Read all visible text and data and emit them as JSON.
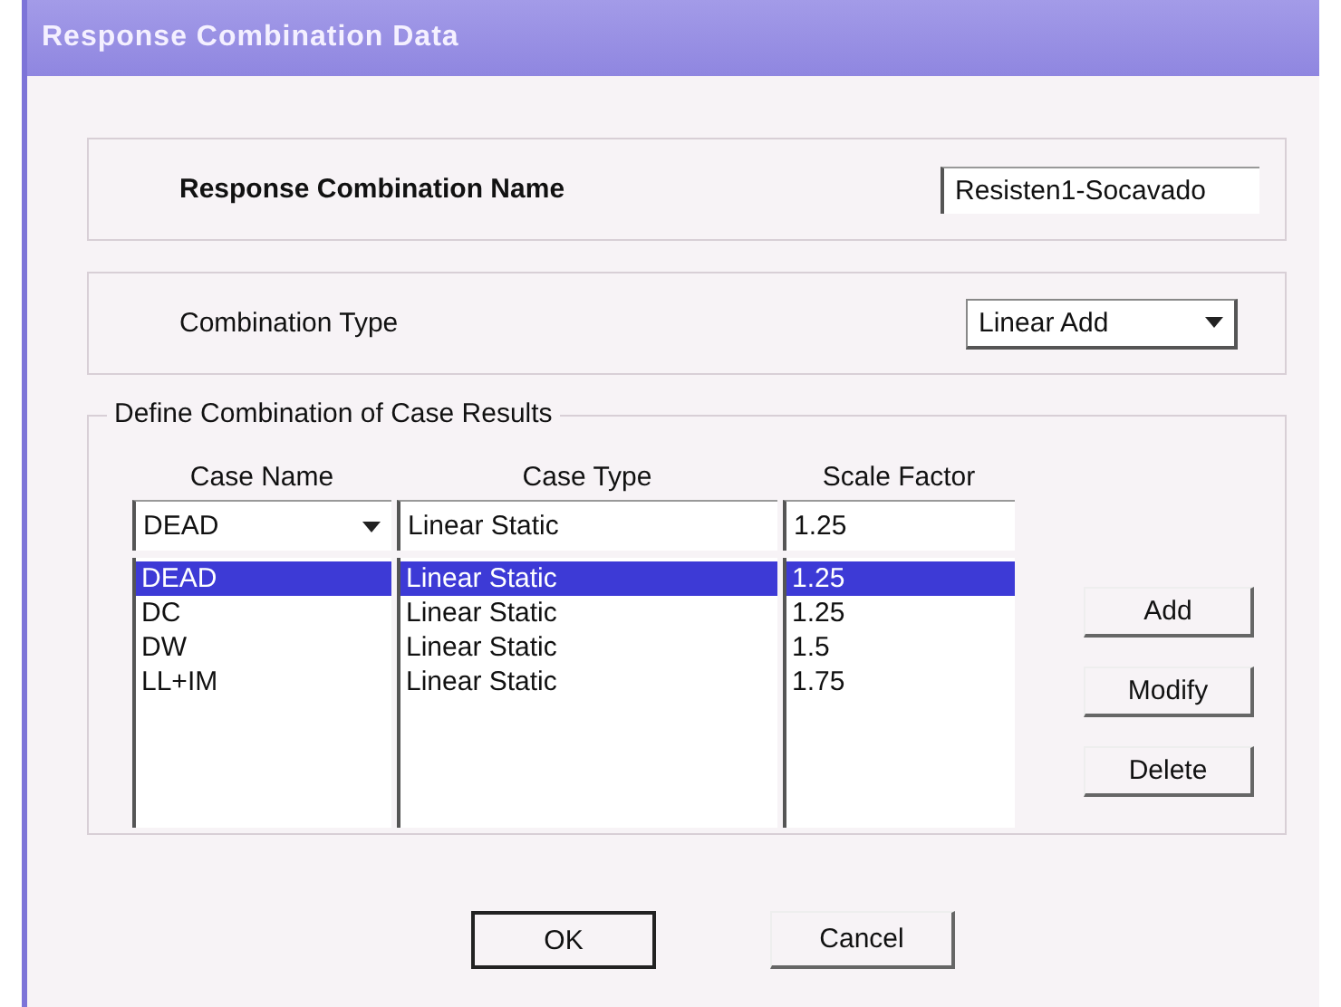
{
  "window": {
    "title": "Response Combination Data"
  },
  "name_group": {
    "label": "Response Combination Name",
    "value": "Resisten1-Socavado"
  },
  "type_group": {
    "label": "Combination Type",
    "value": "Linear Add"
  },
  "cases": {
    "legend": "Define Combination of Case Results",
    "columns": [
      "Case Name",
      "Case Type",
      "Scale Factor"
    ],
    "case_name": "DEAD",
    "case_type": "Linear Static",
    "scale_factor": "1.25",
    "rows": [
      {
        "name": "DEAD",
        "type": "Linear Static",
        "factor": "1.25",
        "selected": true
      },
      {
        "name": "DC",
        "type": "Linear Static",
        "factor": "1.25",
        "selected": false
      },
      {
        "name": "DW",
        "type": "Linear Static",
        "factor": "1.5",
        "selected": false
      },
      {
        "name": "LL+IM",
        "type": "Linear Static",
        "factor": "1.75",
        "selected": false
      }
    ],
    "buttons": [
      "Add",
      "Modify",
      "Delete"
    ]
  },
  "buttons": [
    {
      "label": "OK",
      "default": true
    },
    {
      "label": "Cancel",
      "default": false
    }
  ]
}
